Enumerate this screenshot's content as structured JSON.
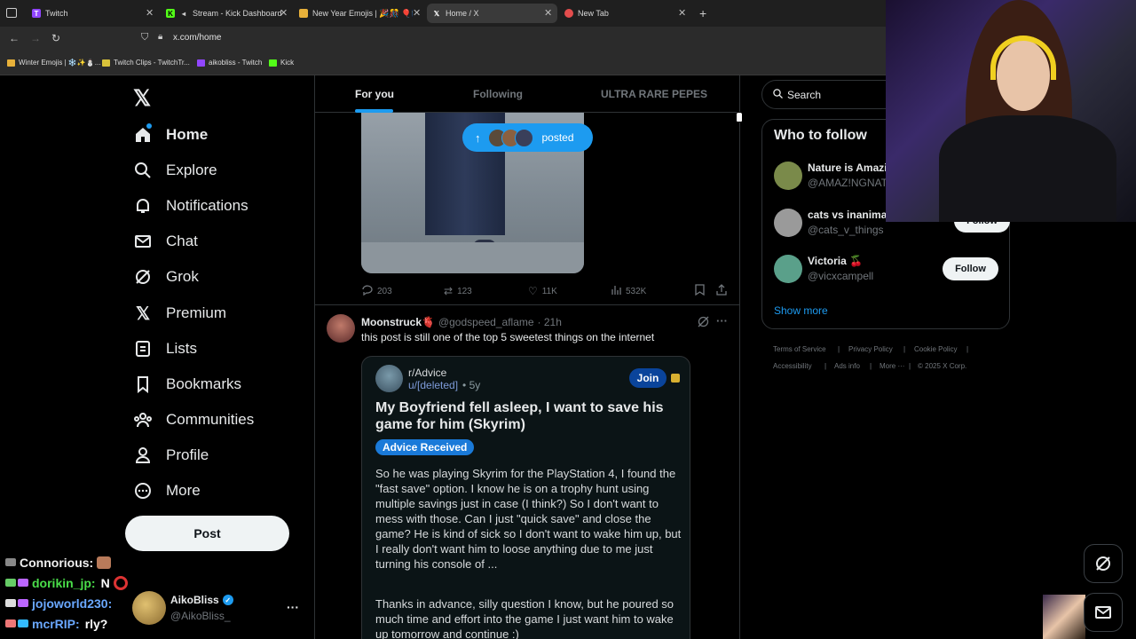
{
  "browser": {
    "tabs": [
      {
        "label": "Twitch",
        "favicon": "T",
        "color": "#9146ff"
      },
      {
        "label": "Stream - Kick Dashboard",
        "favicon": "K",
        "color": "#53fc18"
      },
      {
        "label": "New Year Emojis | 🎉🎊 🎈🎆 ·",
        "favicon": "",
        "color": "#e8b13a"
      },
      {
        "label": "Home / X",
        "favicon": "X",
        "color": "#ffffff"
      },
      {
        "label": "New Tab",
        "favicon": "",
        "color": "#e34d4d"
      }
    ],
    "url": "x.com/home",
    "bookmarks": [
      {
        "label": "Winter Emojis | ❄️✨⛄..."
      },
      {
        "label": "Twitch Clips - TwitchTr..."
      },
      {
        "label": "aikobliss - Twitch"
      },
      {
        "label": "Kick"
      }
    ]
  },
  "nav": {
    "items": [
      "Home",
      "Explore",
      "Notifications",
      "Chat",
      "Grok",
      "Premium",
      "Lists",
      "Bookmarks",
      "Communities",
      "Profile",
      "More"
    ],
    "post_label": "Post",
    "account_name": "AikoBliss",
    "account_handle": "@AikoBliss_",
    "more_dots": "···"
  },
  "chat_overlay": [
    {
      "user": "Connorious:",
      "msg": ""
    },
    {
      "user": "dorikin_jp:",
      "msg": "N"
    },
    {
      "user": "jojoworld230:",
      "msg": ""
    },
    {
      "user": "mcrRIP:",
      "msg": "rly?"
    }
  ],
  "feed": {
    "tabs": [
      "For you",
      "Following",
      "ULTRA RARE PEPES"
    ],
    "posted_pill": "posted",
    "first_post_actions": {
      "replies": "203",
      "reposts": "123",
      "likes": "11K",
      "views": "532K"
    },
    "tweet": {
      "name": "Moonstruck🫀",
      "handle": "@godspeed_aflame",
      "time": "· 21h",
      "text": "this post is still one of the top 5 sweetest things on the internet",
      "reddit": {
        "sub": "r/Advice",
        "user": "u/[deleted]",
        "age": "• 5y",
        "join": "Join",
        "title": "My Boyfriend fell asleep, I want to save his game for him (Skyrim)",
        "flair": "Advice Received",
        "body1": "So he was playing Skyrim for the PlayStation 4, I found the \"fast save\" option. I know he is on a trophy hunt using multiple savings just in case (I think?) So I don't want to mess with those. Can I just \"quick save\" and close the game? He is kind of sick so I don't want to wake him up, but I really don't want him to loose anything due to me just turning his console of ...",
        "body2": "Thanks in advance, silly question I know, but he poured so much time and effort into the game I just want him to wake up tomorrow and continue :)"
      }
    }
  },
  "sidebar": {
    "search_placeholder": "Search",
    "who_to_follow": "Who to follow",
    "users": [
      {
        "name": "Nature is Amazi",
        "handle": "@AMAZ!NGNAT",
        "avatar_color": "#7a8a4a"
      },
      {
        "name": "cats vs inanima",
        "handle": "@cats_v_things",
        "avatar_color": "#9a9a9a"
      },
      {
        "name": "Victoria 🍒",
        "handle": "@vicxcampell",
        "avatar_color": "#5aa08a"
      }
    ],
    "follow_label": "Follow",
    "show_more": "Show more",
    "footer": [
      "Terms of Service",
      "Privacy Policy",
      "Cookie Policy",
      "Accessibility",
      "Ads info",
      "More ···",
      "© 2025 X Corp."
    ]
  },
  "colors": {
    "accent": "#1d9bf0",
    "bg": "#000000",
    "border": "#2f3336",
    "muted": "#71767b"
  }
}
